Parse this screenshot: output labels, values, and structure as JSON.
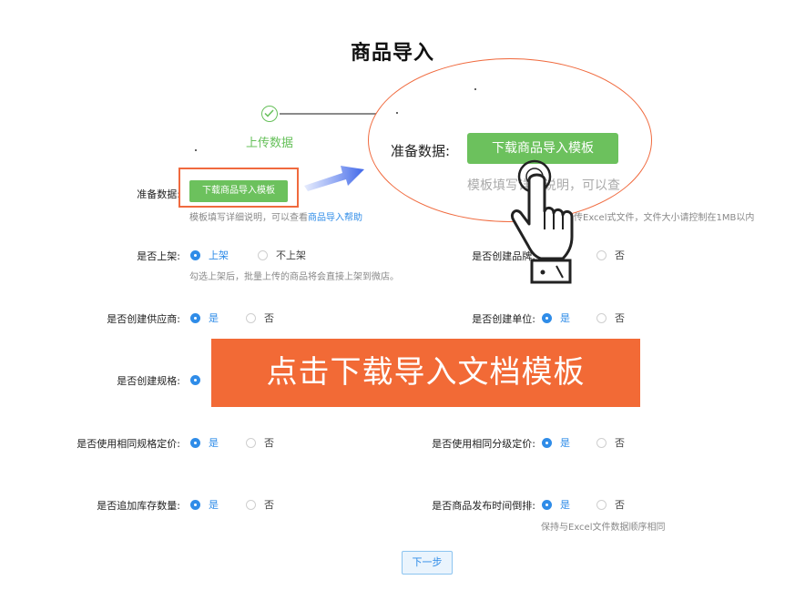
{
  "page": {
    "title": "商品导入"
  },
  "step": {
    "label": "上传数据"
  },
  "prepare": {
    "label": "准备数据:",
    "download_button": "下载商品导入模板",
    "hint_prefix": "模板填写详细说明，可以查看",
    "hint_link": "商品导入帮助",
    "right_hint": "上传Excel式文件，文件大小请控制在1MB以内"
  },
  "magnifier": {
    "label": "准备数据:",
    "button": "下载商品导入模板",
    "hint": "模板填写详细说明，可以查"
  },
  "fields": {
    "on_shelf": {
      "label": "是否上架:",
      "yes": "上架",
      "no": "不上架",
      "hint": "勾选上架后，批量上传的商品将会直接上架到微店。"
    },
    "create_brand": {
      "label": "是否创建品牌:",
      "no": "否"
    },
    "create_supplier": {
      "label": "是否创建供应商:",
      "yes": "是",
      "no": "否"
    },
    "create_unit": {
      "label": "是否创建单位:",
      "yes": "是",
      "no": "否"
    },
    "create_spec": {
      "label": "是否创建规格:"
    },
    "same_spec_price": {
      "label": "是否使用相同规格定价:",
      "yes": "是",
      "no": "否"
    },
    "same_level_price": {
      "label": "是否使用相同分级定价:",
      "yes": "是",
      "no": "否"
    },
    "append_stock": {
      "label": "是否追加库存数量:",
      "yes": "是",
      "no": "否"
    },
    "reverse_time": {
      "label": "是否商品发布时间倒排:",
      "yes": "是",
      "no": "否",
      "hint": "保持与Excel文件数据顺序相同"
    }
  },
  "banner": {
    "text": "点击下载导入文档模板"
  },
  "next_button": "下一步",
  "colors": {
    "accent": "#2f8ce8",
    "green": "#6cc15d",
    "orange": "#f26a36"
  },
  "icons": [
    "check-icon",
    "arrow-icon",
    "hand-pointer-icon"
  ]
}
